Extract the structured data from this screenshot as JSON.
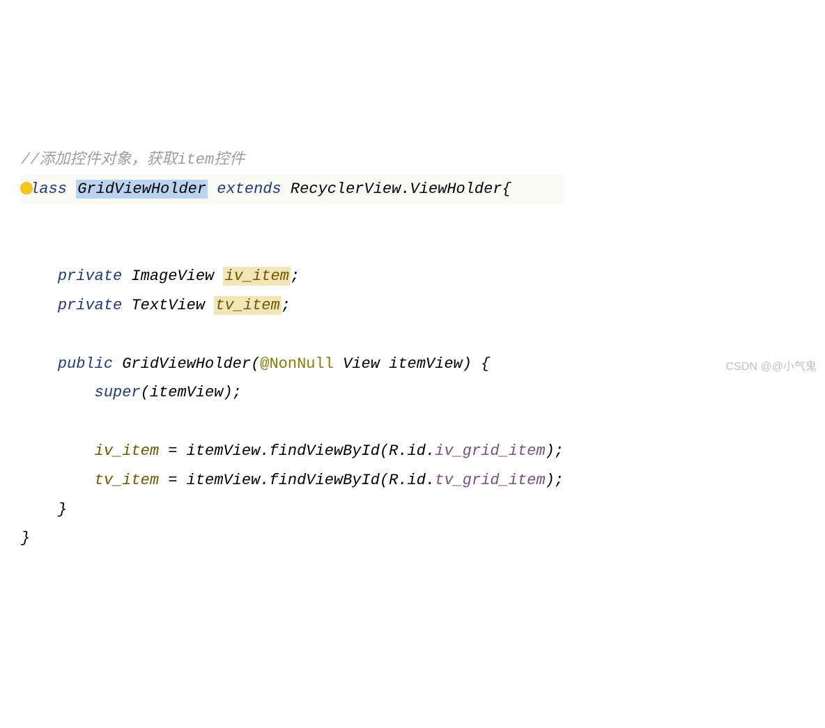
{
  "code": {
    "comment": "//添加控件对象，获取item控件",
    "class_keyword": "class",
    "class_name": "GridViewHolder",
    "extends": "extends",
    "parent_class": "RecyclerView.ViewHolder",
    "brace_open": "{",
    "private1": "private",
    "type1": "ImageView",
    "field1": "iv_item",
    "semi": ";",
    "private2": "private",
    "type2": "TextView",
    "field2": "tv_item",
    "public": "public",
    "constructor": "GridViewHolder",
    "paren_open": "(",
    "annotation": "@NonNull",
    "param_type": "View",
    "param_name": "itemView",
    "paren_close": ")",
    "super": "super",
    "super_arg": "itemView",
    "assign1_left": "iv_item",
    "equals": " = ",
    "assign1_obj": "itemView",
    "dot": ".",
    "findViewById": "findViewById",
    "R": "R",
    "id": "id",
    "assign1_res": "iv_grid_item",
    "assign2_left": "tv_item",
    "assign2_obj": "itemView",
    "assign2_res": "tv_grid_item",
    "brace_close": "}"
  },
  "watermark": "CSDN @@小气鬼"
}
